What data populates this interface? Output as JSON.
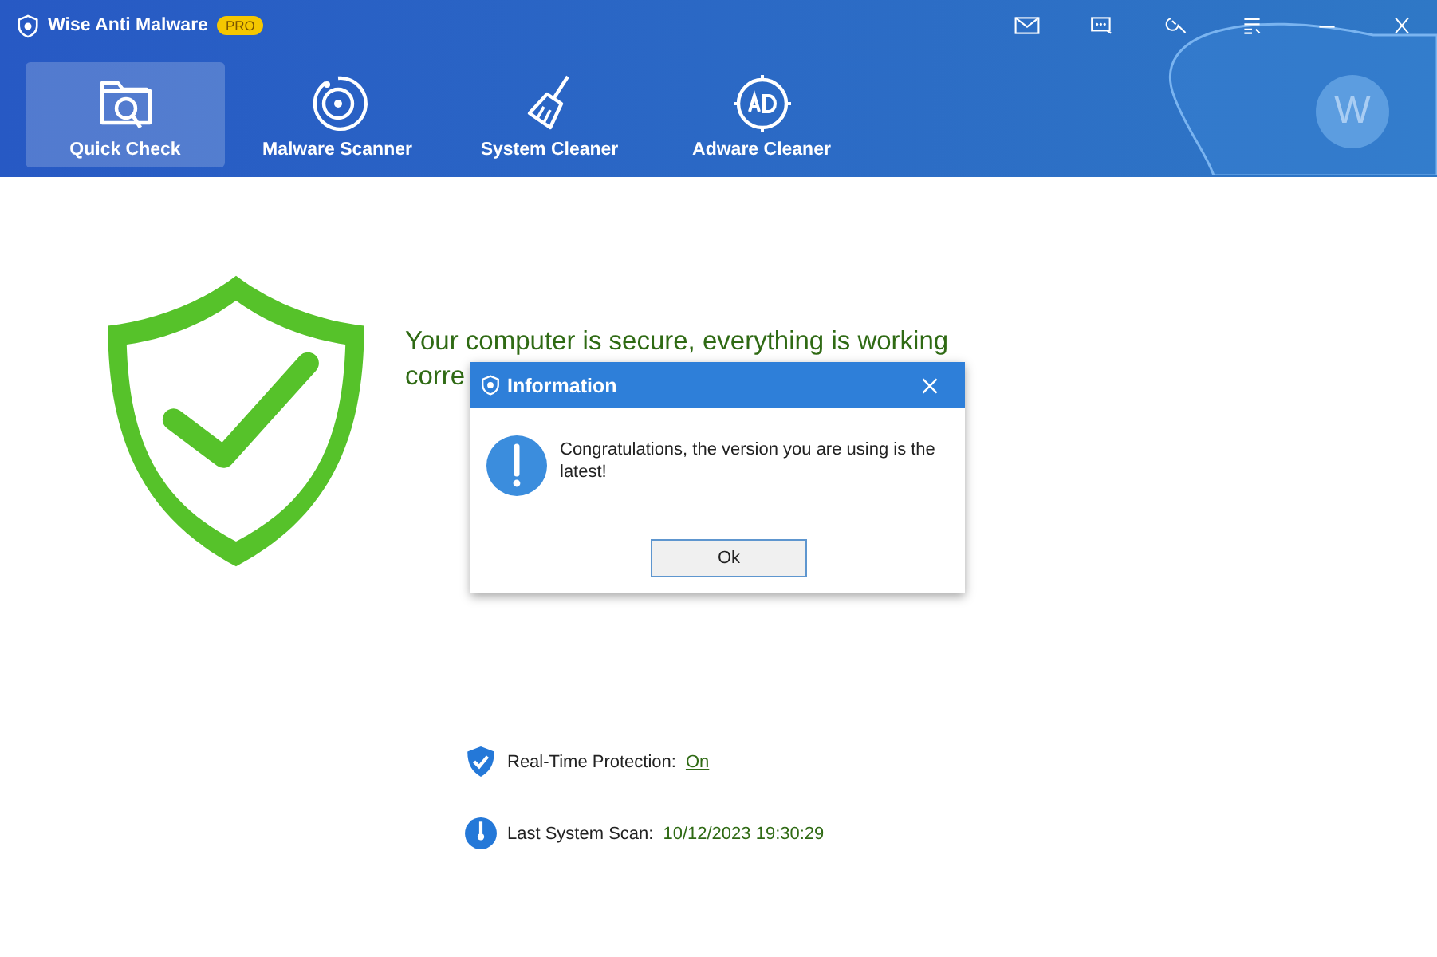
{
  "window": {
    "title": "Wise Anti Malware",
    "badge": "PRO",
    "avatar": "W"
  },
  "tabs": [
    {
      "label": "Quick Check",
      "kind": "folder",
      "selected": true
    },
    {
      "label": "Malware Scanner",
      "kind": "scan",
      "selected": false
    },
    {
      "label": "System Cleaner",
      "kind": "broom",
      "selected": false
    },
    {
      "label": "Adware Cleaner",
      "kind": "ad",
      "selected": false
    }
  ],
  "status": {
    "headline_lines": [
      "Your computer is secure, everything is working",
      "corre"
    ],
    "rows": [
      {
        "kind": "protection",
        "label": "Real-Time Protection:",
        "value": "On",
        "link": true
      },
      {
        "kind": "scan",
        "label": "Last System Scan:",
        "value": "10/12/2023 19:30:29",
        "link": false
      }
    ]
  },
  "dialog": {
    "title": "Information",
    "message": "Congratulations, the version you are using is the latest!",
    "button": "Ok"
  }
}
